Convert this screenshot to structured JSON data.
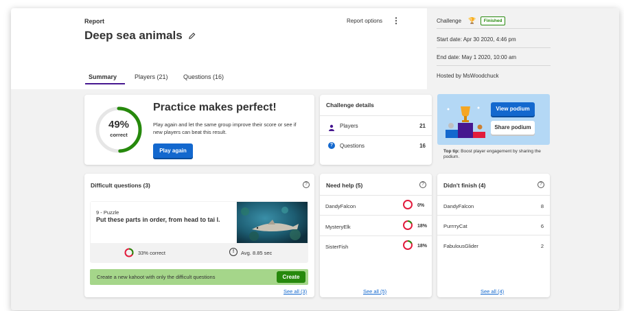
{
  "header": {
    "report_label": "Report",
    "title": "Deep sea animals",
    "report_options": "Report options",
    "tabs": [
      {
        "label": "Summary"
      },
      {
        "label": "Players (21)"
      },
      {
        "label": "Questions (16)"
      }
    ]
  },
  "info_panel": {
    "challenge_label": "Challenge",
    "status_badge": "Finished",
    "start_date": "Start date: Apr 30 2020, 4:46 pm",
    "end_date": "End date: May 1 2020, 10:00 am",
    "hosted_by": "Hosted by MsWoodchuck"
  },
  "summary": {
    "percent": "49%",
    "percent_value": 0.49,
    "correct_label": "correct",
    "headline": "Practice makes perfect!",
    "body": "Play again and let the same group improve their score or see if new players can beat this result.",
    "play_again": "Play again"
  },
  "challenge_details": {
    "title": "Challenge details",
    "players_label": "Players",
    "players_value": "21",
    "questions_label": "Questions",
    "questions_value": "16"
  },
  "podium": {
    "view_podium": "View podium",
    "share_podium": "Share podium",
    "tip_bold": "Top tip:",
    "tip_text": "Boost player engagement by sharing the podium."
  },
  "difficult": {
    "title": "Difficult questions (3)",
    "question_type": "9 - Puzzle",
    "question_text": "Put these parts in order, from head to tai l.",
    "correct": "33% correct",
    "correct_value": 0.33,
    "avg_time": "Avg. 8.85 sec",
    "banner_text": "Create a new kahoot with only the difficult questions",
    "create": "Create",
    "see_all": "See all (3)"
  },
  "need_help": {
    "title": "Need help (5)",
    "rows": [
      {
        "name": "DandyFalcon",
        "pct": "0%",
        "value": 0.0
      },
      {
        "name": "MysteryElk",
        "pct": "18%",
        "value": 0.18
      },
      {
        "name": "SisterFish",
        "pct": "18%",
        "value": 0.18
      }
    ],
    "see_all": "See all (5)"
  },
  "didnt_finish": {
    "title": "Didn't finish (4)",
    "rows": [
      {
        "name": "DandyFalcon",
        "count": "8"
      },
      {
        "name": "PurrrryCat",
        "count": "6"
      },
      {
        "name": "FabulousGlider",
        "count": "2"
      }
    ],
    "see_all": "See all (4)"
  },
  "colors": {
    "accent": "#46178f",
    "blue": "#1368ce",
    "green": "#26890c",
    "red": "#e21b3c",
    "podium_bg": "#b4d8f5"
  }
}
